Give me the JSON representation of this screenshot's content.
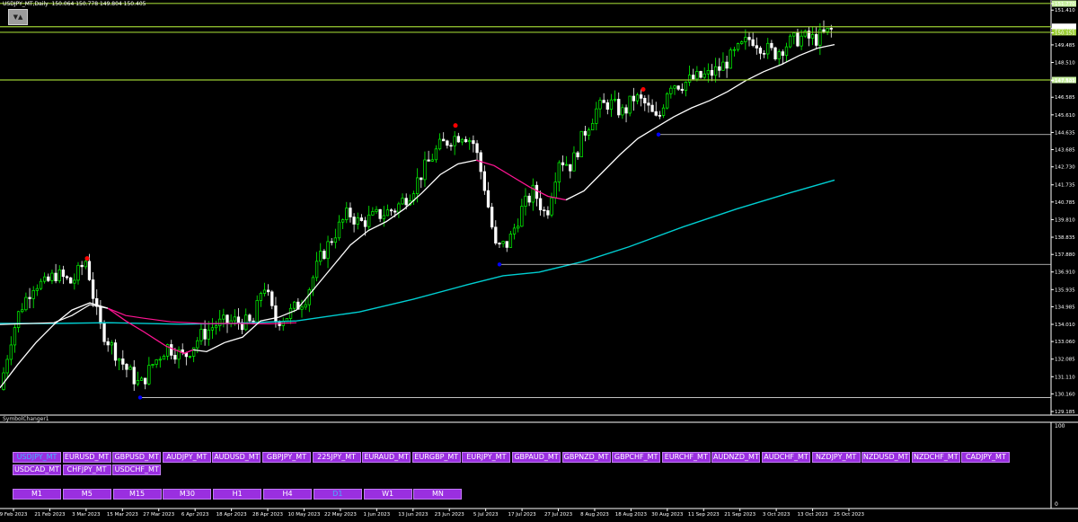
{
  "window": {
    "title": "USDJPY_MT,Daily",
    "ohlc": "150.064 150.778 149.804 150.405",
    "nav_glyph": "▼▲"
  },
  "chart": {
    "price_labels": [
      "151.770",
      "151.410",
      "150.405",
      "150.151",
      "149.485",
      "148.510",
      "147.501",
      "147.535",
      "146.585",
      "145.610",
      "144.635",
      "143.685",
      "142.730",
      "141.735",
      "140.785",
      "139.810",
      "138.835",
      "137.880",
      "136.910",
      "135.935",
      "134.985",
      "134.010",
      "133.060",
      "132.085",
      "131.110",
      "130.160",
      "129.185"
    ],
    "date_labels": [
      "9 Feb 2023",
      "21 Feb 2023",
      "3 Mar 2023",
      "15 Mar 2023",
      "27 Mar 2023",
      "6 Apr 2023",
      "18 Apr 2023",
      "28 Apr 2023",
      "10 May 2023",
      "22 May 2023",
      "1 Jun 2023",
      "13 Jun 2023",
      "23 Jun 2023",
      "5 Jul 2023",
      "17 Jul 2023",
      "27 Jul 2023",
      "8 Aug 2023",
      "18 Aug 2023",
      "30 Aug 2023",
      "11 Sep 2023",
      "21 Sep 2023",
      "3 Oct 2023",
      "13 Oct 2023",
      "25 Oct 2023"
    ],
    "colors": {
      "bull": "#00ff00",
      "bear": "#ffffff",
      "level_line": "#9acd32",
      "ma_fast": "#ffffff",
      "ma_mid_down": "#ff1493",
      "ma_slow": "#00ced1",
      "swing_high": "#ff0000",
      "swing_low": "#0000ff"
    }
  },
  "indicator_panel": {
    "name": "SymbolChanger1",
    "scale_top": "100",
    "scale_bottom": "0",
    "symbols_row1": [
      "USDJPY_MT",
      "EURUSD_MT",
      "GBPUSD_MT",
      "AUDJPY_MT",
      "AUDUSD_MT",
      "GBPJPY_MT",
      "225JPY_MT",
      "EURAUD_MT",
      "EURGBP_MT",
      "EURJPY_MT",
      "GBPAUD_MT",
      "GBPNZD_MT",
      "GBPCHF_MT",
      "EURCHF_MT",
      "AUDNZD_MT",
      "AUDCHF_MT",
      "NZDJPY_MT",
      "NZDUSD_MT",
      "NZDCHF_MT",
      "CADJPY_MT"
    ],
    "symbols_row2": [
      "USDCAD_MT",
      "CHFJPY_MT",
      "USDCHF_MT"
    ],
    "timeframes": [
      "M1",
      "M5",
      "M15",
      "M30",
      "H1",
      "H4",
      "D1",
      "W1",
      "MN"
    ],
    "active_symbol": "USDJPY_MT",
    "active_timeframe": "D1"
  }
}
